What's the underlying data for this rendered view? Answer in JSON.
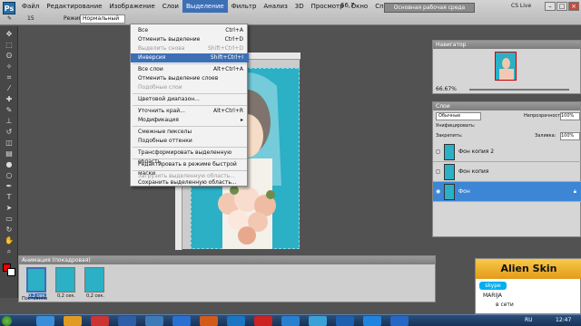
{
  "menu": {
    "logo": "Ps",
    "items": [
      "Файл",
      "Редактирование",
      "Изображение",
      "Слои",
      "Выделение",
      "Фильтр",
      "Анализ",
      "3D",
      "Просмотр",
      "Окно",
      "Справка"
    ],
    "zoom": "66,7",
    "workspace": "Основная рабочая среда",
    "cslive": "CS Live"
  },
  "options": {
    "mode_label": "Режим:",
    "mode_value": "Нормальный",
    "size": "15"
  },
  "dropdown": [
    {
      "label": "Все",
      "key": "Ctrl+A",
      "state": "normal"
    },
    {
      "label": "Отменить выделение",
      "key": "Ctrl+D",
      "state": "normal"
    },
    {
      "label": "Выделить снова",
      "key": "Shift+Ctrl+D",
      "state": "disabled"
    },
    {
      "label": "Инверсия",
      "key": "Shift+Ctrl+I",
      "state": "highlight"
    },
    {
      "sep": true
    },
    {
      "label": "Все слои",
      "key": "Alt+Ctrl+A",
      "state": "normal"
    },
    {
      "label": "Отменить выделение слоев",
      "key": "",
      "state": "normal"
    },
    {
      "label": "Подобные слои",
      "key": "",
      "state": "disabled"
    },
    {
      "sep": true
    },
    {
      "label": "Цветовой диапазон...",
      "key": "",
      "state": "normal"
    },
    {
      "sep": true
    },
    {
      "label": "Уточнить край...",
      "key": "Alt+Ctrl+R",
      "state": "normal"
    },
    {
      "label": "Модификация",
      "key": "▸",
      "state": "normal"
    },
    {
      "sep": true
    },
    {
      "label": "Смежные пикселы",
      "key": "",
      "state": "normal"
    },
    {
      "label": "Подобные оттенки",
      "key": "",
      "state": "normal"
    },
    {
      "sep": true
    },
    {
      "label": "Трансформировать выделенную область",
      "key": "",
      "state": "normal"
    },
    {
      "sep": true
    },
    {
      "label": "Редактировать в режиме быстрой маски",
      "key": "",
      "state": "normal"
    },
    {
      "sep": true
    },
    {
      "label": "Загрузить выделенную область...",
      "key": "",
      "state": "disabled"
    },
    {
      "label": "Сохранить выделенную область...",
      "key": "",
      "state": "normal"
    }
  ],
  "navigator": {
    "title": "Навигатор",
    "zoom": "66.67%"
  },
  "layers": {
    "title": "Слои",
    "blend": "Обычные",
    "opacity_label": "Непрозрачность:",
    "opacity": "100%",
    "unify_label": "Унифицировать:",
    "lock_label": "Закрепить:",
    "fill_label": "Заливка:",
    "fill": "100%",
    "rows": [
      "Фон копия 2",
      "Фон копия",
      "Фон"
    ]
  },
  "animation": {
    "title": "Анимация (покадровая)",
    "frames": [
      {
        "n": "1",
        "t": "0,2 сек."
      },
      {
        "n": "2",
        "t": "0,2 сек."
      },
      {
        "n": "3",
        "t": "0,2 сек."
      }
    ],
    "loop": "Постоянно"
  },
  "ad": {
    "brand": "Alien Skin",
    "status_label": "skype",
    "name": "MARIJA",
    "status": "в сети"
  },
  "taskbar": {
    "lang": "RU",
    "time": "12:47"
  },
  "colors": {
    "accent": "#3d6fb5",
    "photo_bg": "#2bb0c6"
  }
}
